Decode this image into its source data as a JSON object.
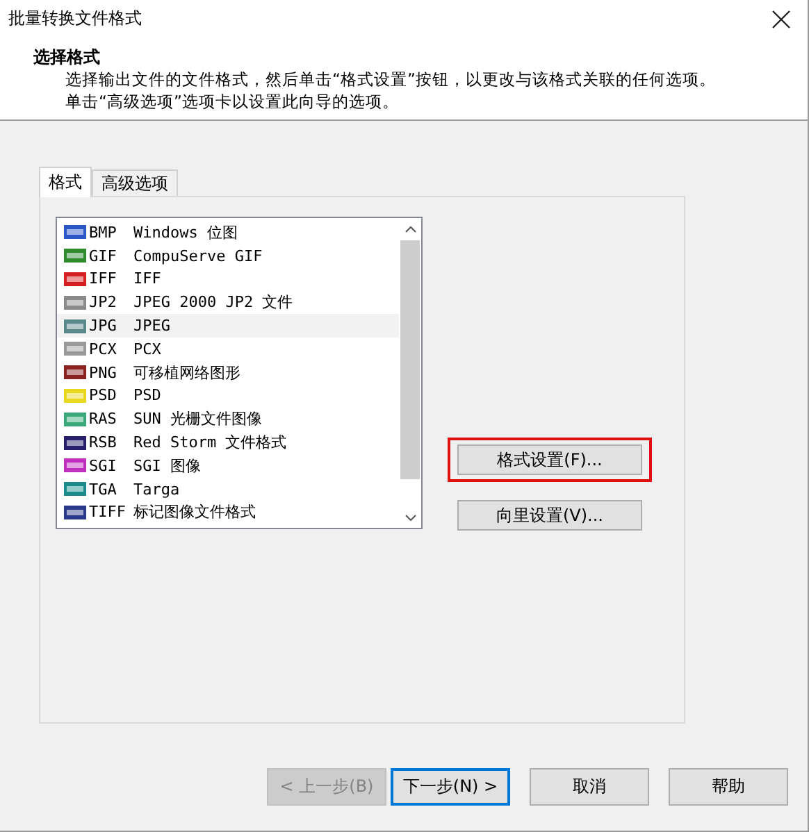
{
  "window": {
    "title": "批量转换文件格式"
  },
  "header": {
    "title": "选择格式",
    "lines": [
      "选择输出文件的文件格式，然后单击“格式设置”按钮，以更改与该格式关联的任何选项。",
      "单击“高级选项”选项卡以设置此向导的选项。"
    ]
  },
  "tabs": [
    {
      "label": "格式",
      "selected": true
    },
    {
      "label": "高级选项",
      "selected": false
    }
  ],
  "formats": [
    {
      "ext": "BMP",
      "name": "Windows 位图",
      "color": "#2a56c6",
      "selected": false
    },
    {
      "ext": "GIF",
      "name": "CompuServe GIF",
      "color": "#2e8b2e",
      "selected": false
    },
    {
      "ext": "IFF",
      "name": "IFF",
      "color": "#d42020",
      "selected": false
    },
    {
      "ext": "JP2",
      "name": "JPEG 2000 JP2 文件",
      "color": "#8a8a8a",
      "selected": false
    },
    {
      "ext": "JPG",
      "name": "JPEG",
      "color": "#5a8a8a",
      "selected": true
    },
    {
      "ext": "PCX",
      "name": "PCX",
      "color": "#9a9a9a",
      "selected": false
    },
    {
      "ext": "PNG",
      "name": "可移植网络图形",
      "color": "#8b2020",
      "selected": false
    },
    {
      "ext": "PSD",
      "name": "PSD",
      "color": "#e8d820",
      "selected": false
    },
    {
      "ext": "RAS",
      "name": "SUN 光栅文件图像",
      "color": "#3aa87a",
      "selected": false
    },
    {
      "ext": "RSB",
      "name": "Red Storm 文件格式",
      "color": "#28206a",
      "selected": false
    },
    {
      "ext": "SGI",
      "name": "SGI 图像",
      "color": "#c030c0",
      "selected": false
    },
    {
      "ext": "TGA",
      "name": "Targa",
      "color": "#1a8a8a",
      "selected": false
    },
    {
      "ext": "TIFF",
      "name": "标记图像文件格式",
      "color": "#2a3a8a",
      "selected": false
    }
  ],
  "side_buttons": [
    {
      "label": "格式设置(F)...",
      "highlighted": true
    },
    {
      "label": "向里设置(V)...",
      "highlighted": false
    }
  ],
  "footer_buttons": [
    {
      "label": "< 上一步(B)",
      "disabled": true,
      "default": false
    },
    {
      "label": "下一步(N) >",
      "disabled": false,
      "default": true
    },
    {
      "label": "取消",
      "disabled": false,
      "default": false
    },
    {
      "label": "帮助",
      "disabled": false,
      "default": false
    }
  ]
}
